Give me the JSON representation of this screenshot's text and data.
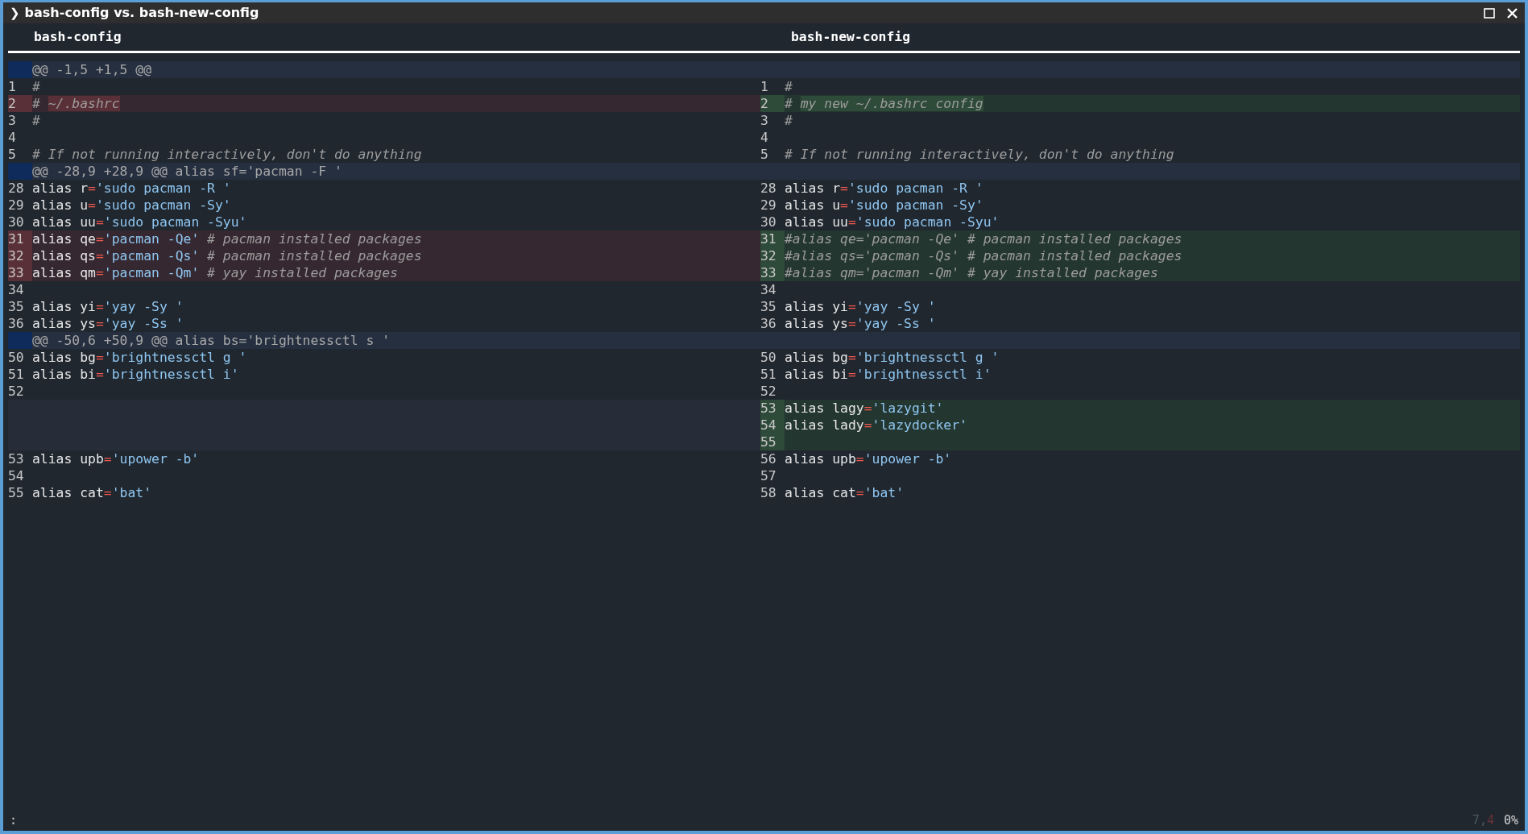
{
  "window": {
    "prompt_glyph": "❯",
    "title": "bash-config vs. bash-new-config"
  },
  "panes": [
    {
      "title": "bash-config",
      "lines": [
        {
          "kind": "hunk",
          "segments": [
            {
              "text": "@@ -1,5 +1,5 @@",
              "kind": "hunk"
            }
          ]
        },
        {
          "kind": "context",
          "number": "1",
          "segments": [
            {
              "text": "#",
              "kind": "comment"
            }
          ]
        },
        {
          "kind": "removed",
          "number": "2",
          "segments": [
            {
              "text": "# ",
              "kind": "comment"
            },
            {
              "text": "~/.bashrc",
              "kind": "changed"
            }
          ]
        },
        {
          "kind": "context",
          "number": "3",
          "segments": [
            {
              "text": "#",
              "kind": "comment"
            }
          ]
        },
        {
          "kind": "context",
          "number": "4"
        },
        {
          "kind": "context",
          "number": "5",
          "segments": [
            {
              "text": "# If not running interactively, don't do anything",
              "kind": "comment"
            }
          ]
        },
        {
          "kind": "hunk",
          "segments": [
            {
              "text": "@@ -28,9 +28,9 @@ alias sf='pacman -F '",
              "kind": "hunk"
            }
          ]
        },
        {
          "kind": "context",
          "number": "28",
          "segments": [
            {
              "text": "alias r",
              "kind": "plain"
            },
            {
              "text": "=",
              "kind": "operator"
            },
            {
              "text": "'sudo pacman -R '",
              "kind": "string"
            }
          ]
        },
        {
          "kind": "context",
          "number": "29",
          "segments": [
            {
              "text": "alias u",
              "kind": "plain"
            },
            {
              "text": "=",
              "kind": "operator"
            },
            {
              "text": "'sudo pacman -Sy'",
              "kind": "string"
            }
          ]
        },
        {
          "kind": "context",
          "number": "30",
          "segments": [
            {
              "text": "alias uu",
              "kind": "plain"
            },
            {
              "text": "=",
              "kind": "operator"
            },
            {
              "text": "'sudo pacman -Syu'",
              "kind": "string"
            }
          ]
        },
        {
          "kind": "removed",
          "number": "31",
          "segments": [
            {
              "text": "alias qe",
              "kind": "plain"
            },
            {
              "text": "=",
              "kind": "operator"
            },
            {
              "text": "'pacman -Qe'",
              "kind": "string"
            },
            {
              "text": " # pacman installed packages",
              "kind": "comment"
            }
          ]
        },
        {
          "kind": "removed",
          "number": "32",
          "segments": [
            {
              "text": "alias qs",
              "kind": "plain"
            },
            {
              "text": "=",
              "kind": "operator"
            },
            {
              "text": "'pacman -Qs'",
              "kind": "string"
            },
            {
              "text": " # pacman installed packages",
              "kind": "comment"
            }
          ]
        },
        {
          "kind": "removed",
          "number": "33",
          "segments": [
            {
              "text": "alias qm",
              "kind": "plain"
            },
            {
              "text": "=",
              "kind": "operator"
            },
            {
              "text": "'pacman -Qm'",
              "kind": "string"
            },
            {
              "text": " # yay installed packages",
              "kind": "comment"
            }
          ]
        },
        {
          "kind": "context",
          "number": "34"
        },
        {
          "kind": "context",
          "number": "35",
          "segments": [
            {
              "text": "alias yi",
              "kind": "plain"
            },
            {
              "text": "=",
              "kind": "operator"
            },
            {
              "text": "'yay -Sy '",
              "kind": "string"
            }
          ]
        },
        {
          "kind": "context",
          "number": "36",
          "segments": [
            {
              "text": "alias ys",
              "kind": "plain"
            },
            {
              "text": "=",
              "kind": "operator"
            },
            {
              "text": "'yay -Ss '",
              "kind": "string"
            }
          ]
        },
        {
          "kind": "hunk",
          "segments": [
            {
              "text": "@@ -50,6 +50,9 @@ alias bs='brightnessctl s '",
              "kind": "hunk"
            }
          ]
        },
        {
          "kind": "context",
          "number": "50",
          "segments": [
            {
              "text": "alias bg",
              "kind": "plain"
            },
            {
              "text": "=",
              "kind": "operator"
            },
            {
              "text": "'brightnessctl g '",
              "kind": "string"
            }
          ]
        },
        {
          "kind": "context",
          "number": "51",
          "segments": [
            {
              "text": "alias bi",
              "kind": "plain"
            },
            {
              "text": "=",
              "kind": "operator"
            },
            {
              "text": "'brightnessctl i'",
              "kind": "string"
            }
          ]
        },
        {
          "kind": "context",
          "number": "52"
        },
        {
          "kind": "filler"
        },
        {
          "kind": "filler"
        },
        {
          "kind": "filler"
        },
        {
          "kind": "context",
          "number": "53",
          "segments": [
            {
              "text": "alias upb",
              "kind": "plain"
            },
            {
              "text": "=",
              "kind": "operator"
            },
            {
              "text": "'upower -b'",
              "kind": "string"
            }
          ]
        },
        {
          "kind": "context",
          "number": "54"
        },
        {
          "kind": "context",
          "number": "55",
          "segments": [
            {
              "text": "alias cat",
              "kind": "plain"
            },
            {
              "text": "=",
              "kind": "operator"
            },
            {
              "text": "'bat'",
              "kind": "string"
            }
          ]
        }
      ]
    },
    {
      "title": "bash-new-config",
      "lines": [
        {
          "kind": "hunk"
        },
        {
          "kind": "context",
          "number": "1",
          "segments": [
            {
              "text": "#",
              "kind": "comment"
            }
          ]
        },
        {
          "kind": "added",
          "number": "2",
          "segments": [
            {
              "text": "# ",
              "kind": "comment"
            },
            {
              "text": "my new ~/.bashrc config",
              "kind": "changed"
            }
          ]
        },
        {
          "kind": "context",
          "number": "3",
          "segments": [
            {
              "text": "#",
              "kind": "comment"
            }
          ]
        },
        {
          "kind": "context",
          "number": "4"
        },
        {
          "kind": "context",
          "number": "5",
          "segments": [
            {
              "text": "# If not running interactively, don't do anything",
              "kind": "comment"
            }
          ]
        },
        {
          "kind": "hunk"
        },
        {
          "kind": "context",
          "number": "28",
          "segments": [
            {
              "text": "alias r",
              "kind": "plain"
            },
            {
              "text": "=",
              "kind": "operator"
            },
            {
              "text": "'sudo pacman -R '",
              "kind": "string"
            }
          ]
        },
        {
          "kind": "context",
          "number": "29",
          "segments": [
            {
              "text": "alias u",
              "kind": "plain"
            },
            {
              "text": "=",
              "kind": "operator"
            },
            {
              "text": "'sudo pacman -Sy'",
              "kind": "string"
            }
          ]
        },
        {
          "kind": "context",
          "number": "30",
          "segments": [
            {
              "text": "alias uu",
              "kind": "plain"
            },
            {
              "text": "=",
              "kind": "operator"
            },
            {
              "text": "'sudo pacman -Syu'",
              "kind": "string"
            }
          ]
        },
        {
          "kind": "added",
          "number": "31",
          "segments": [
            {
              "text": "#alias qe='pacman -Qe' # pacman installed packages",
              "kind": "comment"
            }
          ]
        },
        {
          "kind": "added",
          "number": "32",
          "segments": [
            {
              "text": "#alias qs='pacman -Qs' # pacman installed packages",
              "kind": "comment"
            }
          ]
        },
        {
          "kind": "added",
          "number": "33",
          "segments": [
            {
              "text": "#alias qm='pacman -Qm' # yay installed packages",
              "kind": "comment"
            }
          ]
        },
        {
          "kind": "context",
          "number": "34"
        },
        {
          "kind": "context",
          "number": "35",
          "segments": [
            {
              "text": "alias yi",
              "kind": "plain"
            },
            {
              "text": "=",
              "kind": "operator"
            },
            {
              "text": "'yay -Sy '",
              "kind": "string"
            }
          ]
        },
        {
          "kind": "context",
          "number": "36",
          "segments": [
            {
              "text": "alias ys",
              "kind": "plain"
            },
            {
              "text": "=",
              "kind": "operator"
            },
            {
              "text": "'yay -Ss '",
              "kind": "string"
            }
          ]
        },
        {
          "kind": "hunk"
        },
        {
          "kind": "context",
          "number": "50",
          "segments": [
            {
              "text": "alias bg",
              "kind": "plain"
            },
            {
              "text": "=",
              "kind": "operator"
            },
            {
              "text": "'brightnessctl g '",
              "kind": "string"
            }
          ]
        },
        {
          "kind": "context",
          "number": "51",
          "segments": [
            {
              "text": "alias bi",
              "kind": "plain"
            },
            {
              "text": "=",
              "kind": "operator"
            },
            {
              "text": "'brightnessctl i'",
              "kind": "string"
            }
          ]
        },
        {
          "kind": "context",
          "number": "52"
        },
        {
          "kind": "added",
          "number": "53",
          "segments": [
            {
              "text": "alias lagy",
              "kind": "plain"
            },
            {
              "text": "=",
              "kind": "operator"
            },
            {
              "text": "'lazygit'",
              "kind": "string"
            }
          ]
        },
        {
          "kind": "added",
          "number": "54",
          "segments": [
            {
              "text": "alias lady",
              "kind": "plain"
            },
            {
              "text": "=",
              "kind": "operator"
            },
            {
              "text": "'lazydocker'",
              "kind": "string"
            }
          ]
        },
        {
          "kind": "added",
          "number": "55"
        },
        {
          "kind": "context",
          "number": "56",
          "segments": [
            {
              "text": "alias upb",
              "kind": "plain"
            },
            {
              "text": "=",
              "kind": "operator"
            },
            {
              "text": "'upower -b'",
              "kind": "string"
            }
          ]
        },
        {
          "kind": "context",
          "number": "57"
        },
        {
          "kind": "context",
          "number": "58",
          "segments": [
            {
              "text": "alias cat",
              "kind": "plain"
            },
            {
              "text": "=",
              "kind": "operator"
            },
            {
              "text": "'bat'",
              "kind": "string"
            }
          ]
        }
      ]
    }
  ],
  "status_bar": {
    "command": ":",
    "position": [
      {
        "text": "7",
        "color": "#4b5a5c"
      },
      {
        "text": ",",
        "color": "#4b5a5c"
      },
      {
        "text": "4",
        "color": "#6b3236"
      }
    ],
    "percent": "0%"
  }
}
